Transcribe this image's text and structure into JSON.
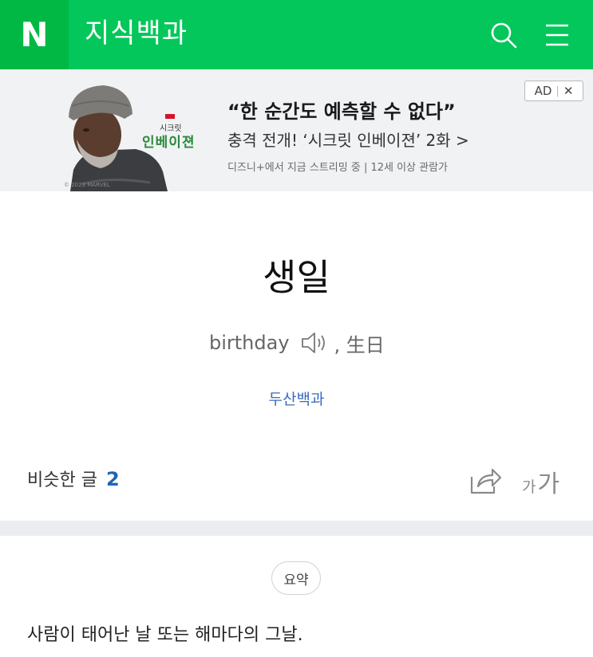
{
  "header": {
    "logo_letter": "N",
    "app_title": "지식백과",
    "brand_color": "#03c75a",
    "icons": [
      "search-icon",
      "menu-icon"
    ]
  },
  "ad": {
    "copyright": "© 2023 MARVEL",
    "brand_small": "시크릿",
    "brand_big": "인베이젼",
    "headline": "“한 순간도 예측할 수 없다”",
    "subline": "충격 전개! ‘시크릿 인베이젼’ 2화 >",
    "fine_print": "디즈니+에서 지금 스트리밍 중 | 12세 이상 관람가",
    "badge_label": "AD",
    "close_glyph": "✕"
  },
  "entry": {
    "title": "생일",
    "english": "birthday",
    "hanja": ", 生日",
    "source": "두산백과"
  },
  "toolbar": {
    "similar_label": "비슷한 글",
    "similar_count": "2",
    "font_small": "가",
    "font_large": "가"
  },
  "summary": {
    "pill_label": "요약",
    "text": "사람이 태어난 날 또는 해마다의 그날."
  }
}
